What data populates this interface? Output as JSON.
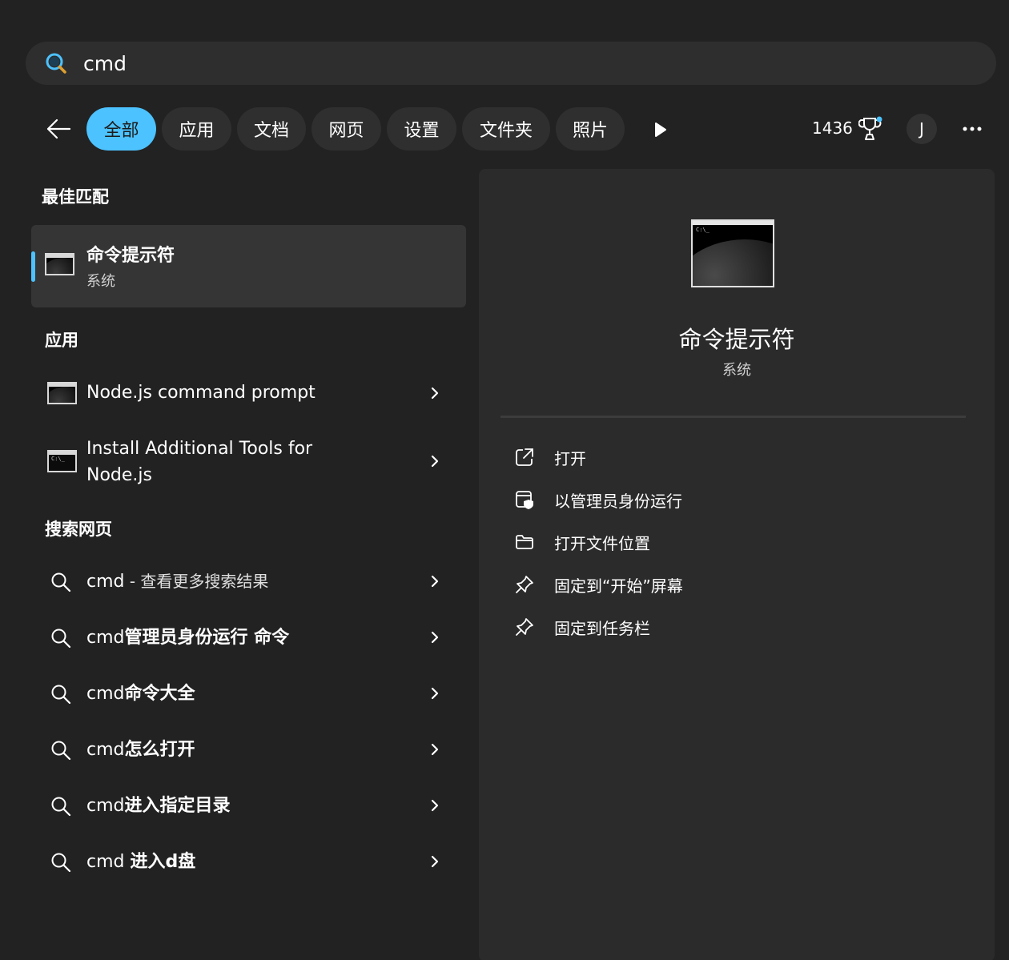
{
  "search": {
    "value": "cmd"
  },
  "filters": [
    {
      "label": "全部",
      "active": true
    },
    {
      "label": "应用",
      "active": false
    },
    {
      "label": "文档",
      "active": false
    },
    {
      "label": "网页",
      "active": false
    },
    {
      "label": "设置",
      "active": false
    },
    {
      "label": "文件夹",
      "active": false
    },
    {
      "label": "照片",
      "active": false
    }
  ],
  "header": {
    "points": "1436",
    "avatar_initial": "J"
  },
  "sections": {
    "best_match": "最佳匹配",
    "apps": "应用",
    "web": "搜索网页"
  },
  "best_match": {
    "title": "命令提示符",
    "subtitle": "系统"
  },
  "apps": [
    {
      "label": "Node.js command prompt"
    },
    {
      "line1": "Install Additional Tools for",
      "line2": "Node.js"
    }
  ],
  "web_results": [
    {
      "query": "cmd",
      "suffix": " - 查看更多搜索结果"
    },
    {
      "query": "cmd",
      "suffix": "管理员身份运行 命令"
    },
    {
      "query": "cmd",
      "suffix": "命令大全"
    },
    {
      "query": "cmd",
      "suffix": "怎么打开"
    },
    {
      "query": "cmd",
      "suffix": "进入指定目录"
    },
    {
      "query": "cmd ",
      "suffix": "进入d盘"
    }
  ],
  "detail": {
    "title": "命令提示符",
    "subtitle": "系统",
    "icon_prompt": "C:\\_",
    "actions": [
      {
        "label": "打开",
        "icon": "open-external-icon"
      },
      {
        "label": "以管理员身份运行",
        "icon": "run-as-admin-icon"
      },
      {
        "label": "打开文件位置",
        "icon": "folder-icon"
      },
      {
        "label": "固定到“开始”屏幕",
        "icon": "pin-icon"
      },
      {
        "label": "固定到任务栏",
        "icon": "pin-icon"
      }
    ]
  },
  "colors": {
    "accent": "#4cc2ff",
    "background": "#222222",
    "panel": "#2b2b2b"
  }
}
